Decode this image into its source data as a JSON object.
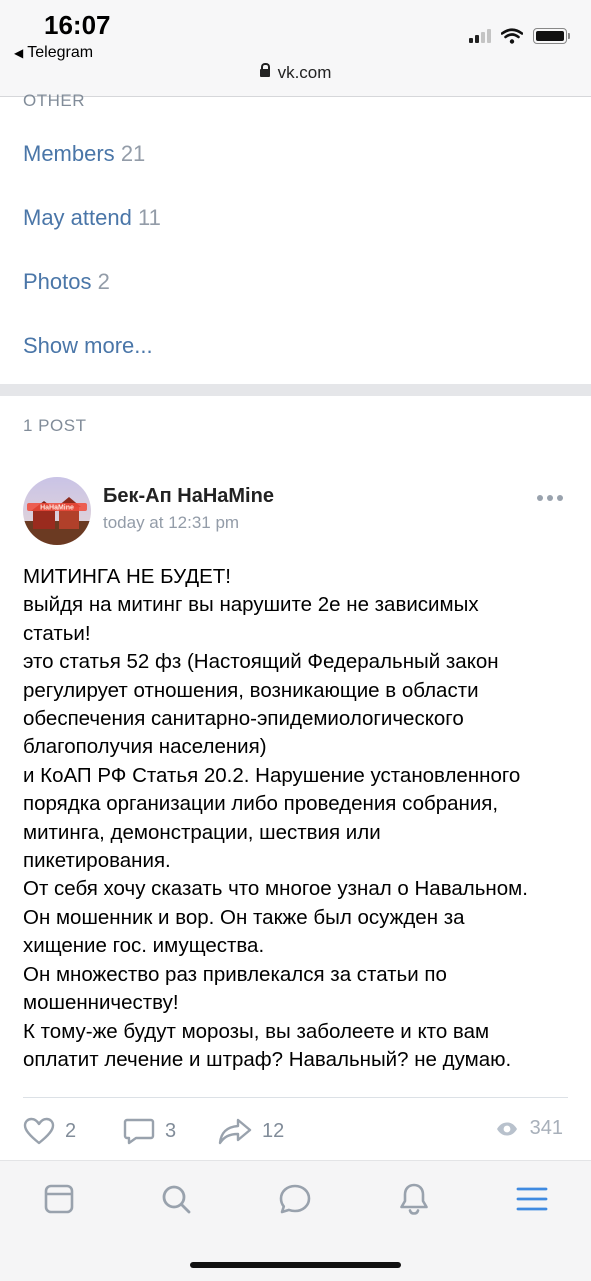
{
  "status_bar": {
    "time": "16:07",
    "back_label": "Telegram",
    "url": "vk.com"
  },
  "other_section": {
    "heading": "OTHER",
    "items": [
      {
        "label": "Members",
        "count": "21"
      },
      {
        "label": "May attend",
        "count": "11"
      },
      {
        "label": "Photos",
        "count": "2"
      }
    ],
    "show_more": "Show more..."
  },
  "posts_section": {
    "heading": "1 POST"
  },
  "post": {
    "author": "Бек-Ап НаНаMine",
    "time": "today at 12:31 pm",
    "avatar_text": "НаНаMine",
    "lines": [
      "МИТИНГА НЕ БУДЕТ!",
      "выйдя на митинг вы нарушите 2е не зависимых",
      "статьи!",
      "это статья 52 фз (Настоящий Федеральный закон",
      "регулирует отношения, возникающие в области",
      "обеспечения санитарно-эпидемиологического",
      "благополучия населения)",
      "и КоАП РФ Статья 20.2. Нарушение установленного",
      "порядка организации либо проведения собрания,",
      "митинга, демонстрации, шествия или",
      "пикетирования.",
      "От себя хочу сказать что многое узнал о Навальном.",
      "Он мошенник и вор. Он также был осужден за",
      "хищение гос. имущества.",
      "Он множество раз привлекался за статьи по",
      "мошенничеству!",
      "К тому-же будут морозы, вы заболеете и кто вам",
      "оплатит лечение и штраф? Навальный? не думаю."
    ],
    "likes": "2",
    "comments": "3",
    "shares": "12",
    "views": "341"
  },
  "colors": {
    "link": "#4a76a8",
    "muted": "#818c99",
    "accent": "#3f8ae0"
  },
  "tab_bar": {
    "icons": [
      "feed-icon",
      "search-icon",
      "messages-icon",
      "notifications-icon",
      "menu-icon"
    ]
  }
}
